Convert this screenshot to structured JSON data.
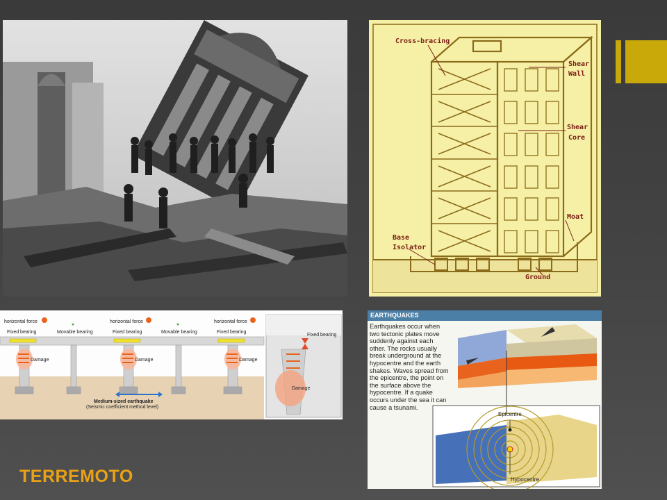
{
  "slide": {
    "title": "TERREMOTO",
    "accent_color": "#c9a80a",
    "title_color": "#e9a215"
  },
  "blueprint": {
    "labels": {
      "cross_bracing": "Cross-bracing",
      "shear_wall_1": "Shear",
      "shear_wall_2": "Wall",
      "shear_core_1": "Shear",
      "shear_core_2": "Core",
      "moat": "Moat",
      "base_isolator_1": "Base",
      "base_isolator_2": "Isolator",
      "ground": "Ground"
    }
  },
  "bridge": {
    "horizontal_force": "horizontal force",
    "fixed_bearing": "Fixed bearing",
    "movable_bearing": "Movable bearing",
    "damage": "Damage",
    "quake_label": "Medium-sized earthquake",
    "quake_sub": "(Seismic coefficient method level)"
  },
  "earthquakes": {
    "heading": "EARTHQUAKES",
    "body": "Earthquakes occur when two tectonic plates move suddenly against each other. The rocks usually break underground at the hypocentre and the earth shakes. Waves spread from the epicentre, the point on the surface above the hypocentre. If a quake occurs under the sea it can cause a tsunami.",
    "epicentre": "Epicentre",
    "hypocentre": "Hypocentre"
  }
}
